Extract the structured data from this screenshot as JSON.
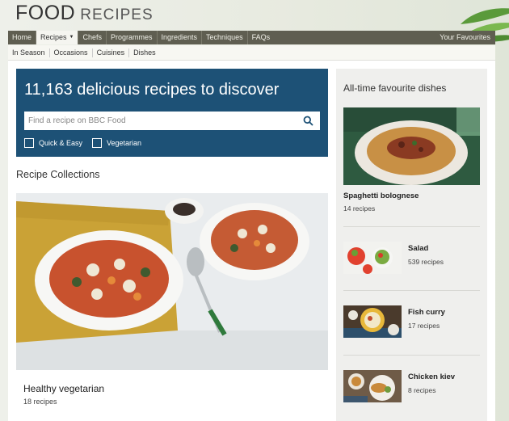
{
  "brand": {
    "word1": "FOOD",
    "word2": "RECIPES"
  },
  "main_nav": {
    "items": [
      "Home",
      "Recipes",
      "Chefs",
      "Programmes",
      "Ingredients",
      "Techniques",
      "FAQs"
    ],
    "favourites": "Your Favourites"
  },
  "sub_nav": {
    "items": [
      "In Season",
      "Occasions",
      "Cuisines",
      "Dishes"
    ]
  },
  "hero": {
    "headline": "11,163 delicious recipes to discover",
    "search_placeholder": "Find a recipe on BBC Food",
    "filters": [
      "Quick & Easy",
      "Vegetarian"
    ]
  },
  "collections": {
    "title": "Recipe Collections",
    "featured": {
      "name": "Healthy vegetarian",
      "count": "18 recipes"
    }
  },
  "sidebar": {
    "title": "All-time favourite dishes",
    "featured": {
      "name": "Spaghetti bolognese",
      "count": "14 recipes"
    },
    "items": [
      {
        "name": "Salad",
        "count": "539 recipes"
      },
      {
        "name": "Fish curry",
        "count": "17 recipes"
      },
      {
        "name": "Chicken kiev",
        "count": "8 recipes"
      }
    ]
  },
  "colors": {
    "nav": "#5f5e51",
    "hero": "#1d5176",
    "sidebar": "#efefed"
  }
}
